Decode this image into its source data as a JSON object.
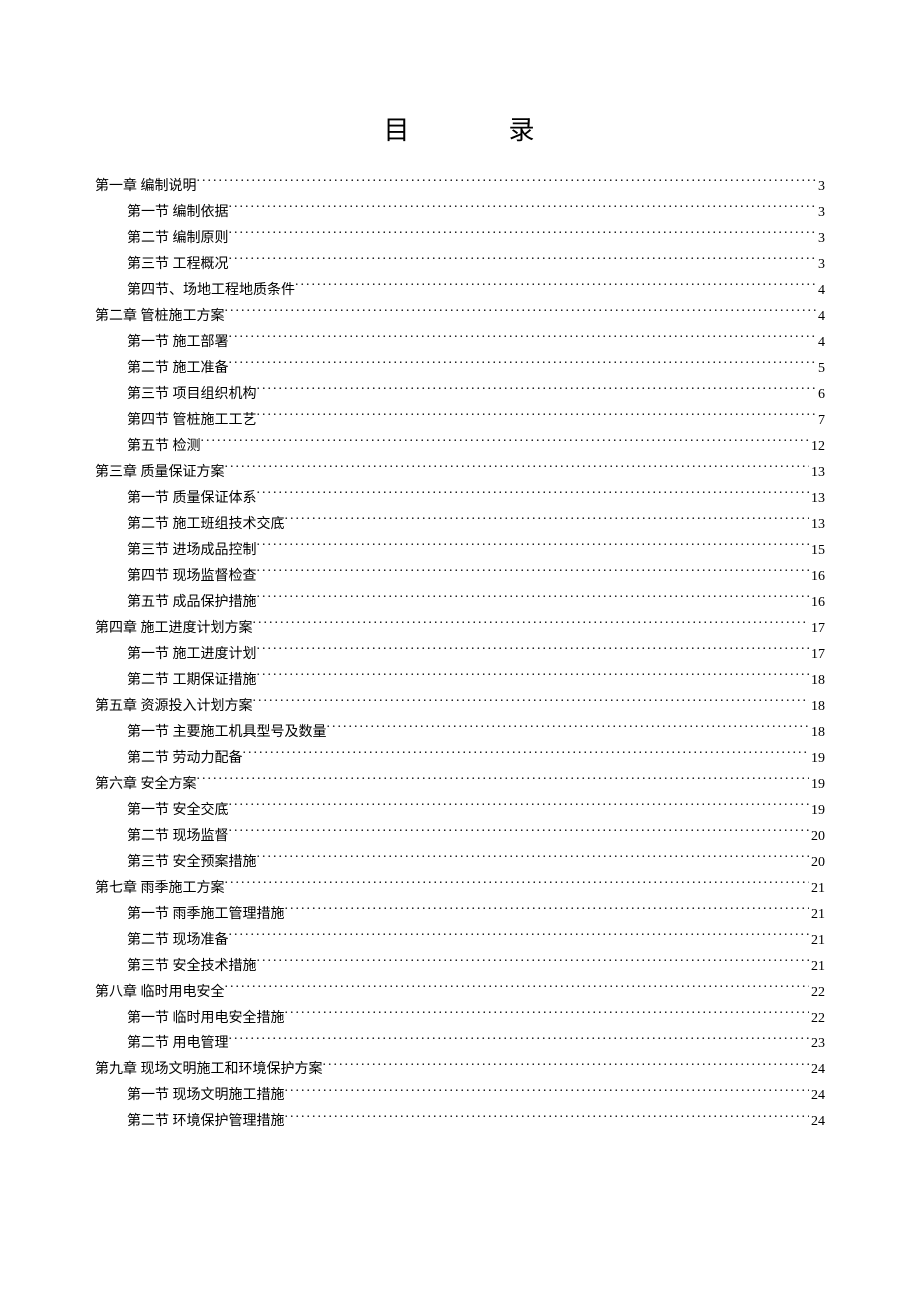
{
  "title_parts": {
    "a": "目",
    "b": "录"
  },
  "toc": [
    {
      "level": 0,
      "label": "第一章   编制说明",
      "page": "3"
    },
    {
      "level": 1,
      "label": "第一节   编制依据",
      "page": "3"
    },
    {
      "level": 1,
      "label": "第二节   编制原则",
      "page": "3"
    },
    {
      "level": 1,
      "label": "第三节  工程概况",
      "page": "3"
    },
    {
      "level": 1,
      "label": "第四节、场地工程地质条件",
      "page": "4"
    },
    {
      "level": 0,
      "label": "第二章   管桩施工方案",
      "page": "4"
    },
    {
      "level": 1,
      "label": "第一节   施工部署",
      "page": "4"
    },
    {
      "level": 1,
      "label": "第二节   施工准备",
      "page": "5"
    },
    {
      "level": 1,
      "label": "第三节     项目组织机构",
      "page": "6"
    },
    {
      "level": 1,
      "label": "第四节    管桩施工工艺",
      "page": "7"
    },
    {
      "level": 1,
      "label": "第五节  检测",
      "page": "12"
    },
    {
      "level": 0,
      "label": "第三章   质量保证方案",
      "page": "13"
    },
    {
      "level": 1,
      "label": "第一节 质量保证体系",
      "page": "13"
    },
    {
      "level": 1,
      "label": "第二节  施工班组技术交底",
      "page": "13"
    },
    {
      "level": 1,
      "label": "第三节  进场成品控制",
      "page": "15"
    },
    {
      "level": 1,
      "label": "第四节  现场监督检查",
      "page": "16"
    },
    {
      "level": 1,
      "label": "第五节  成品保护措施",
      "page": "16"
    },
    {
      "level": 0,
      "label": "第四章   施工进度计划方案",
      "page": "17"
    },
    {
      "level": 1,
      "label": "第一节  施工进度计划",
      "page": "17"
    },
    {
      "level": 1,
      "label": "第二节  工期保证措施",
      "page": "18"
    },
    {
      "level": 0,
      "label": "第五章   资源投入计划方案",
      "page": "18"
    },
    {
      "level": 1,
      "label": "第一节  主要施工机具型号及数量",
      "page": "18"
    },
    {
      "level": 1,
      "label": "第二节  劳动力配备",
      "page": "19"
    },
    {
      "level": 0,
      "label": "第六章  安全方案",
      "page": "19"
    },
    {
      "level": 1,
      "label": "第一节  安全交底",
      "page": "19"
    },
    {
      "level": 1,
      "label": "第二节  现场监督",
      "page": "20"
    },
    {
      "level": 1,
      "label": "第三节  安全预案措施",
      "page": "20"
    },
    {
      "level": 0,
      "label": "第七章  雨季施工方案",
      "page": "21"
    },
    {
      "level": 1,
      "label": "第一节  雨季施工管理措施",
      "page": "21"
    },
    {
      "level": 1,
      "label": "第二节  现场准备",
      "page": "21"
    },
    {
      "level": 1,
      "label": "第三节   安全技术措施",
      "page": "21"
    },
    {
      "level": 0,
      "label": "第八章   临时用电安全",
      "page": "22"
    },
    {
      "level": 1,
      "label": "第一节  临时用电安全措施",
      "page": "22"
    },
    {
      "level": 1,
      "label": "第二节  用电管理",
      "page": "23"
    },
    {
      "level": 0,
      "label": "第九章  现场文明施工和环境保护方案",
      "page": "24"
    },
    {
      "level": 1,
      "label": "第一节  现场文明施工措施",
      "page": "24"
    },
    {
      "level": 1,
      "label": "第二节  环境保护管理措施",
      "page": "24"
    }
  ]
}
